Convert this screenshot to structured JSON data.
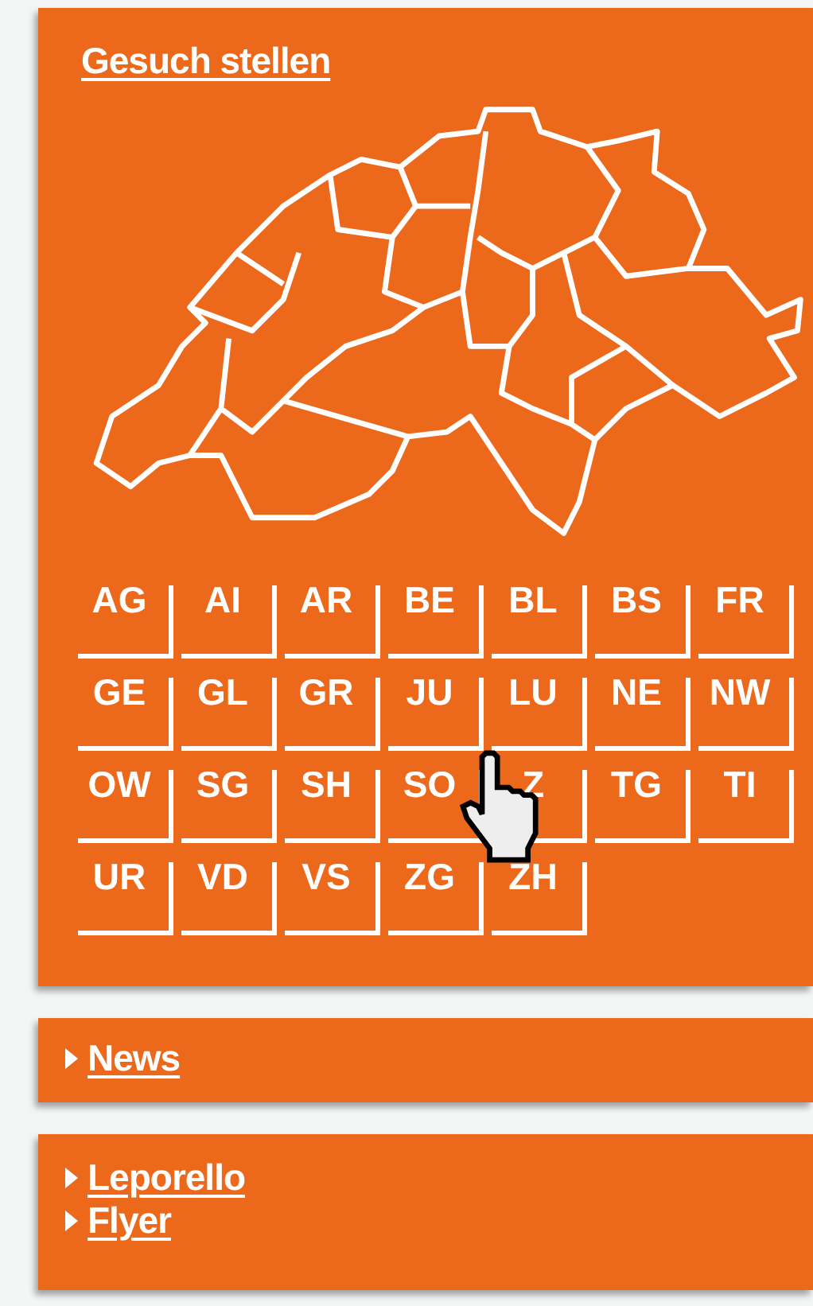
{
  "main_panel": {
    "title": "Gesuch stellen",
    "cantons": [
      "AG",
      "AI",
      "AR",
      "BE",
      "BL",
      "BS",
      "FR",
      "GE",
      "GL",
      "GR",
      "JU",
      "LU",
      "NE",
      "NW",
      "OW",
      "SG",
      "SH",
      "SO",
      "Z",
      "TG",
      "TI",
      "UR",
      "VD",
      "VS",
      "ZG",
      "ZH"
    ]
  },
  "panels": [
    {
      "links": [
        "News"
      ]
    },
    {
      "links": [
        "Leporello",
        "Flyer"
      ]
    }
  ]
}
